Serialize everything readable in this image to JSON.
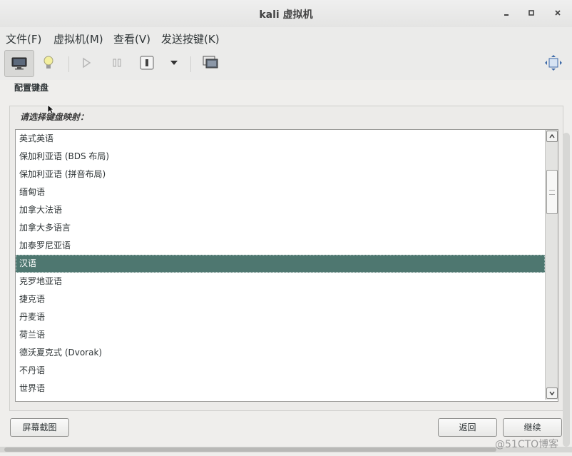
{
  "window": {
    "title": "kali 虚拟机",
    "minimize_label": "–",
    "maximize_label": "□",
    "close_label": "×"
  },
  "menubar": {
    "items": [
      {
        "label": "文件(F)"
      },
      {
        "label": "虚拟机(M)"
      },
      {
        "label": "查看(V)"
      },
      {
        "label": "发送按键(K)"
      }
    ]
  },
  "toolbar": {
    "buttons": [
      {
        "icon": "monitor-icon"
      },
      {
        "icon": "lightbulb-icon"
      },
      {
        "icon": "play-icon"
      },
      {
        "icon": "pause-icon"
      },
      {
        "icon": "power-icon"
      },
      {
        "icon": "dropdown-arrow-icon"
      },
      {
        "icon": "snapshot-icon"
      },
      {
        "icon": "fullscreen-icon"
      }
    ]
  },
  "installer": {
    "section_title": "配置键盘",
    "prompt": "请选择键盘映射：",
    "keymaps": [
      "英式英语",
      "保加利亚语 (BDS 布局)",
      "保加利亚语 (拼音布局)",
      "缅甸语",
      "加拿大法语",
      "加拿大多语言",
      "加泰罗尼亚语",
      "汉语",
      "克罗地亚语",
      "捷克语",
      "丹麦语",
      "荷兰语",
      "德沃夏克式 (Dvorak)",
      "不丹语",
      "世界语"
    ],
    "selected_keymap": "汉语",
    "buttons": {
      "screenshot": "屏幕截图",
      "back": "返回",
      "continue": "继续"
    }
  },
  "watermark": "@51CTO博客",
  "colors": {
    "selection": "#4e7770",
    "window_bg": "#efeeec"
  }
}
